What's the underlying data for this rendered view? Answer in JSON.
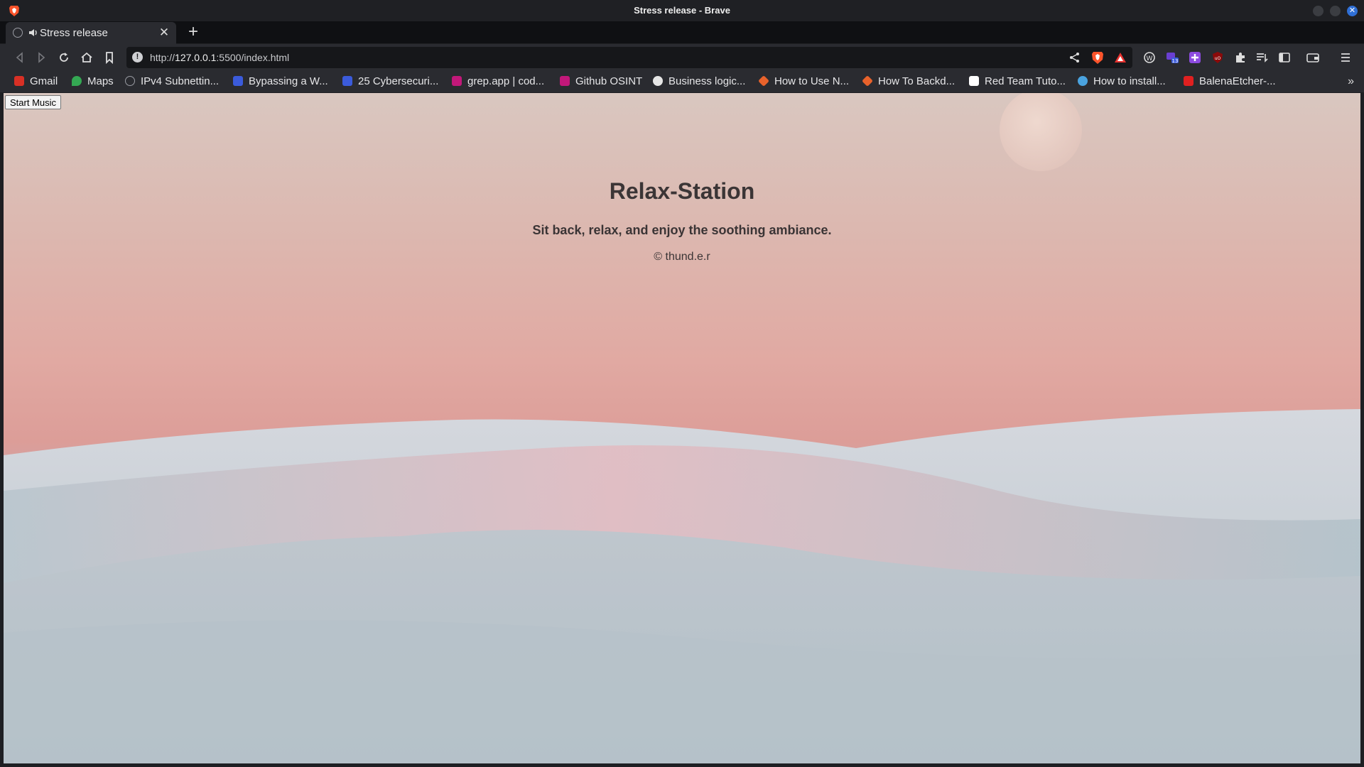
{
  "window": {
    "title": "Stress release - Brave"
  },
  "tab": {
    "title": "Stress release"
  },
  "urlbar": {
    "scheme": "http://",
    "host": "127.0.0.1",
    "rest": ":5500/index.html"
  },
  "bookmarks": [
    {
      "label": "Gmail",
      "icon": "gmail-icon",
      "color": "#d93025"
    },
    {
      "label": "Maps",
      "icon": "maps-icon",
      "color": "#34a853"
    },
    {
      "label": "IPv4 Subnettin...",
      "icon": "globe-icon",
      "color": "#9a9ca3"
    },
    {
      "label": "Bypassing a W...",
      "icon": "site-icon",
      "color": "#3b5bdb"
    },
    {
      "label": "25 Cybersecuri...",
      "icon": "site-icon",
      "color": "#3b5bdb"
    },
    {
      "label": "grep.app | cod...",
      "icon": "grep-icon",
      "color": "#c2187a"
    },
    {
      "label": "Github OSINT",
      "icon": "grep-icon",
      "color": "#c2187a"
    },
    {
      "label": "Business logic...",
      "icon": "portswigger-icon",
      "color": "#e6e6e6"
    },
    {
      "label": "How to Use N...",
      "icon": "diamond-icon",
      "color": "#e8622b"
    },
    {
      "label": "How To Backd...",
      "icon": "diamond-icon",
      "color": "#e8622b"
    },
    {
      "label": "Red Team Tuto...",
      "icon": "medium-icon",
      "color": "#ffffff"
    },
    {
      "label": "How to install...",
      "icon": "wordpress-icon",
      "color": "#4aa3df"
    },
    {
      "label": "BalenaEtcher-...",
      "icon": "h-icon",
      "color": "#e02020"
    }
  ],
  "page": {
    "button_label": "Start Music",
    "heading": "Relax-Station",
    "subtitle": "Sit back, relax, and enjoy the soothing ambiance.",
    "copyright": "© thund.e.r"
  },
  "colors": {
    "accent": "#2f6fd6",
    "brave": "#fb542b"
  }
}
